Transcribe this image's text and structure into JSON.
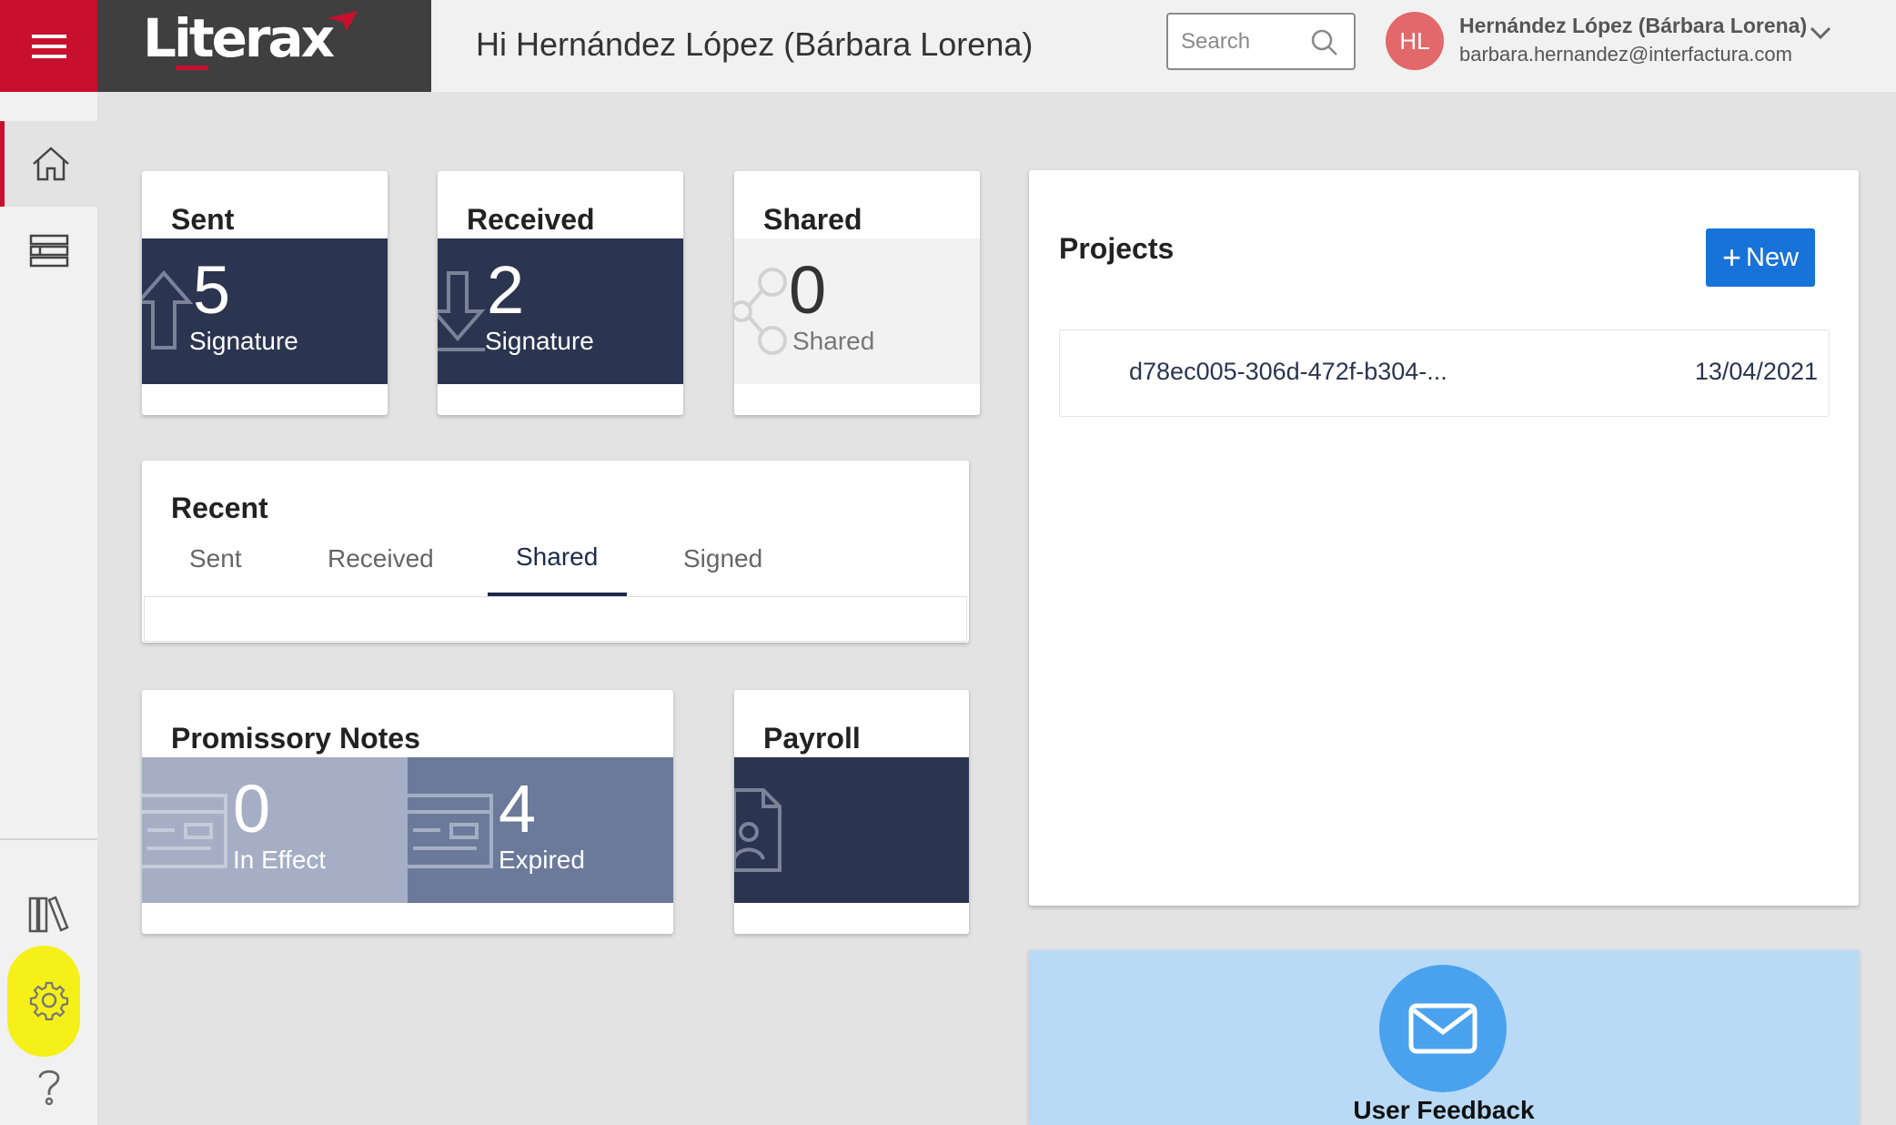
{
  "header": {
    "brand": "Literax",
    "greeting": "Hi Hernández López (Bárbara Lorena)",
    "search_placeholder": "Search",
    "user": {
      "initials": "HL",
      "name": "Hernández López (Bárbara Lorena)",
      "email": "barbara.hernandez@interfactura.com"
    }
  },
  "sidebar": {
    "items": [
      {
        "icon": "home-icon",
        "active": true
      },
      {
        "icon": "table-list-icon",
        "active": false
      },
      {
        "icon": "library-icon",
        "active": false
      },
      {
        "icon": "gear-icon",
        "active": false
      },
      {
        "icon": "help-icon",
        "active": false
      }
    ]
  },
  "cards": {
    "sent": {
      "title": "Sent",
      "count": "5",
      "label": "Signature"
    },
    "received": {
      "title": "Received",
      "count": "2",
      "label": "Signature"
    },
    "shared": {
      "title": "Shared",
      "count": "0",
      "label": "Shared"
    },
    "recent": {
      "title": "Recent",
      "tabs": [
        "Sent",
        "Received",
        "Shared",
        "Signed"
      ],
      "active_tab": "Shared"
    },
    "promissory": {
      "title": "Promissory Notes",
      "in_effect": {
        "count": "0",
        "label": "In Effect"
      },
      "expired": {
        "count": "4",
        "label": "Expired"
      }
    },
    "payroll": {
      "title": "Payroll"
    }
  },
  "projects": {
    "title": "Projects",
    "new_label": "New",
    "rows": [
      {
        "name": "d78ec005-306d-472f-b304-...",
        "date": "13/04/2021"
      }
    ]
  },
  "feedback": {
    "label": "User Feedback"
  },
  "colors": {
    "brand_red": "#c8102e",
    "navy_tile": "#2b3550",
    "accent_blue": "#1873d8",
    "highlight_yellow": "#f5f018"
  }
}
